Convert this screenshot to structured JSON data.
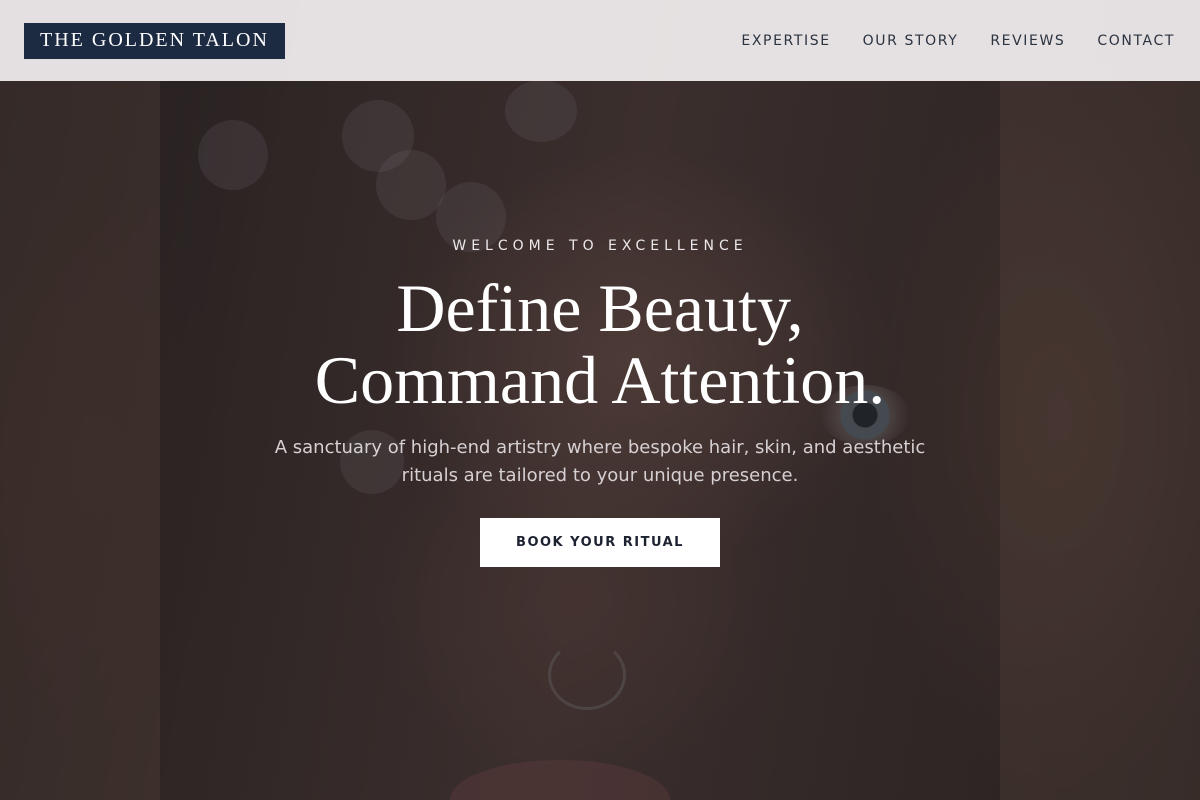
{
  "brand": {
    "logo_text": "THE GOLDEN TALON"
  },
  "nav": {
    "links": [
      {
        "label": "EXPERTISE"
      },
      {
        "label": "OUR STORY"
      },
      {
        "label": "REVIEWS"
      },
      {
        "label": "CONTACT"
      }
    ]
  },
  "hero": {
    "eyebrow": "WELCOME TO EXCELLENCE",
    "headline_line1": "Define Beauty,",
    "headline_line2": "Command Attention.",
    "subtext": "A sanctuary of high-end artistry where bespoke hair, skin, and aesthetic rituals are tailored to your unique presence.",
    "cta_label": "BOOK YOUR RITUAL"
  },
  "colors": {
    "logo_background": "#1c2a42",
    "nav_background": "#ece8e9",
    "nav_text": "#2b3340",
    "cta_background": "#ffffff",
    "cta_text": "#1c2230"
  }
}
